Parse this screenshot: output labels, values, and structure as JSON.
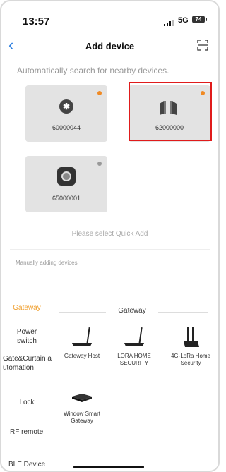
{
  "status_bar": {
    "time": "13:57",
    "network": "5G",
    "battery": "74"
  },
  "header": {
    "title": "Add device"
  },
  "auto_search_text": "Automatically search for nearby devices.",
  "found_devices": [
    {
      "id": "60000044",
      "icon": "bluetooth-icon",
      "dot_color": "#f08a24"
    },
    {
      "id": "62000000",
      "icon": "door-sensor-icon",
      "dot_color": "#f08a24"
    },
    {
      "id": "65000001",
      "icon": "gateway-icon",
      "dot_color": "#999999"
    }
  ],
  "quick_add_text": "Please select Quick Add",
  "manual_text": "Manually adding devices",
  "categories": [
    {
      "label": "Gateway",
      "active": true
    },
    {
      "label": "Power switch"
    },
    {
      "label": "Gate&Curtain automation"
    },
    {
      "label": "Lock"
    },
    {
      "label": "RF remote"
    },
    {
      "label": "BLE Device"
    }
  ],
  "section": {
    "title": "Gateway"
  },
  "products": [
    {
      "label": "Gateway Host",
      "icon": "router-icon"
    },
    {
      "label": "LORA HOME SECURITY",
      "icon": "router-icon"
    },
    {
      "label": "4G-LoRa Home Security",
      "icon": "dual-antenna-router-icon"
    },
    {
      "label": "Window Smart Gateway",
      "icon": "flat-router-icon"
    }
  ],
  "colors": {
    "accent": "#f0a030",
    "link": "#2d7fe0",
    "highlight": "#e01b1b"
  }
}
